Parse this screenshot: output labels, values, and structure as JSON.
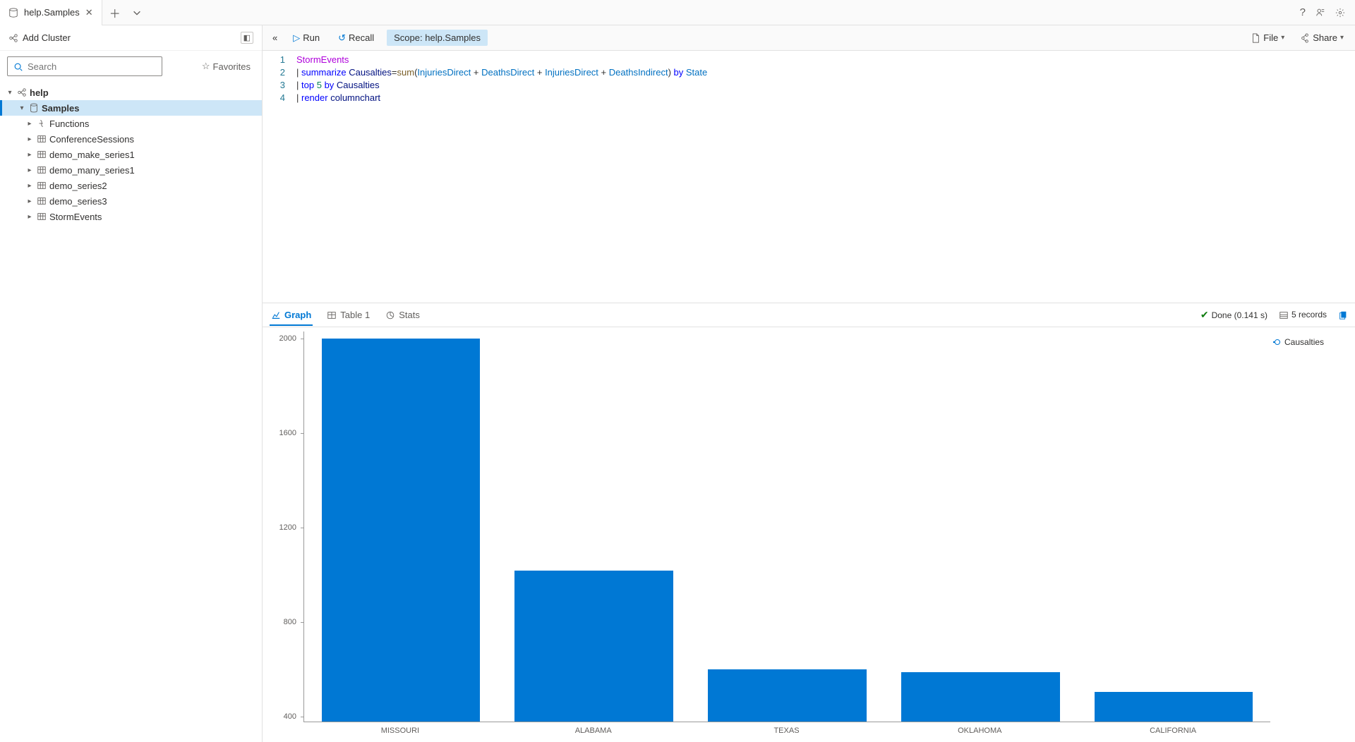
{
  "tab": {
    "title": "help.Samples"
  },
  "top_icons": {
    "help": "?",
    "feedback": "feedback",
    "settings": "settings"
  },
  "sidebar": {
    "addCluster": "Add Cluster",
    "searchPlaceholder": "Search",
    "favorites": "Favorites",
    "tree": {
      "root": "help",
      "db": "Samples",
      "items": [
        {
          "label": "Functions",
          "kind": "fn"
        },
        {
          "label": "ConferenceSessions",
          "kind": "table"
        },
        {
          "label": "demo_make_series1",
          "kind": "table"
        },
        {
          "label": "demo_many_series1",
          "kind": "table"
        },
        {
          "label": "demo_series2",
          "kind": "table"
        },
        {
          "label": "demo_series3",
          "kind": "table"
        },
        {
          "label": "StormEvents",
          "kind": "table"
        }
      ]
    }
  },
  "toolbar": {
    "run": "Run",
    "recall": "Recall",
    "scopeLabel": "Scope:",
    "scopeValue": "help.Samples",
    "file": "File",
    "share": "Share"
  },
  "editor": {
    "lines": [
      "1",
      "2",
      "3",
      "4"
    ],
    "l1_table": "StormEvents",
    "l2_kw1": "summarize",
    "l2_col": "Causalties",
    "l2_fn": "sum",
    "l2_a1": "InjuriesDirect",
    "l2_a2": "DeathsDirect",
    "l2_a3": "InjuriesDirect",
    "l2_a4": "DeathsIndirect",
    "l2_by": "by",
    "l2_state": "State",
    "l3_kw": "top",
    "l3_n": "5",
    "l3_by": "by",
    "l3_col": "Causalties",
    "l4_kw": "render",
    "l4_type": "columnchart"
  },
  "results": {
    "tabs": {
      "graph": "Graph",
      "table": "Table 1",
      "stats": "Stats"
    },
    "status": {
      "done": "Done (0.141 s)",
      "records": "5 records"
    }
  },
  "legend": {
    "series": "Causalties"
  },
  "chart_data": {
    "type": "bar",
    "categories": [
      "MISSOURI",
      "ALABAMA",
      "TEXAS",
      "OKLAHOMA",
      "CALIFORNIA"
    ],
    "values": [
      2000,
      1020,
      600,
      590,
      505
    ],
    "yticks": [
      400,
      800,
      1200,
      1600,
      2000
    ],
    "ylim": [
      380,
      2030
    ],
    "series_name": "Causalties"
  }
}
